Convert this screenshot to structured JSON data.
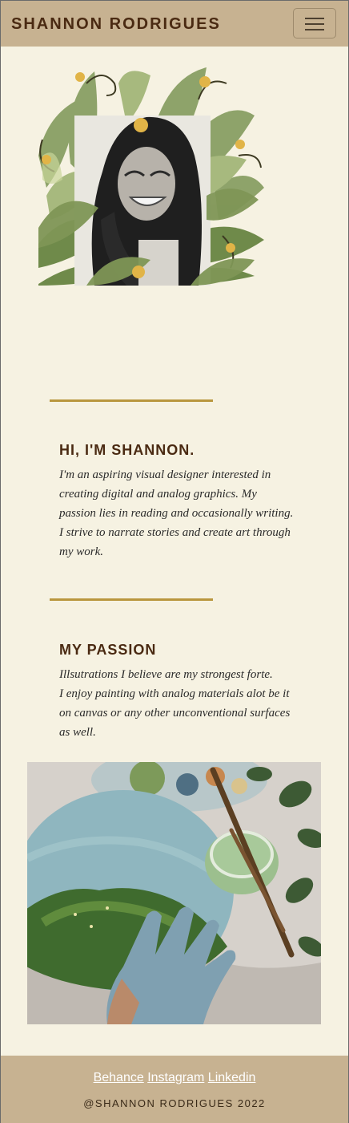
{
  "navbar": {
    "brand": "SHANNON RODRIGUES",
    "toggle_icon": "hamburger-menu-icon"
  },
  "hero": {
    "image": "portrait-with-leaves-illustration"
  },
  "intro": {
    "heading": "HI, I'M SHANNON.",
    "body": "I'm an aspiring visual designer interested in creating digital and analog graphics. My passion lies in reading and occasionally writing. I strive to narrate stories and create art through my work."
  },
  "passion": {
    "heading": "MY PASSION",
    "lines": [
      "Illsutrations I believe are my strongest forte.",
      "I enjoy painting with analog materials alot be it",
      "on canvas or any other unconventional surfaces as well."
    ],
    "image": "painting-on-round-canvas-photo"
  },
  "footer": {
    "links": [
      "Behance",
      "Instagram",
      "Linkedin"
    ],
    "copyright": "@SHANNON RODRIGUES 2022"
  },
  "colors": {
    "background": "#f6f2e2",
    "navbar": "#c7b291",
    "accent_rule": "#b9973e",
    "heading": "#4a2a12"
  }
}
